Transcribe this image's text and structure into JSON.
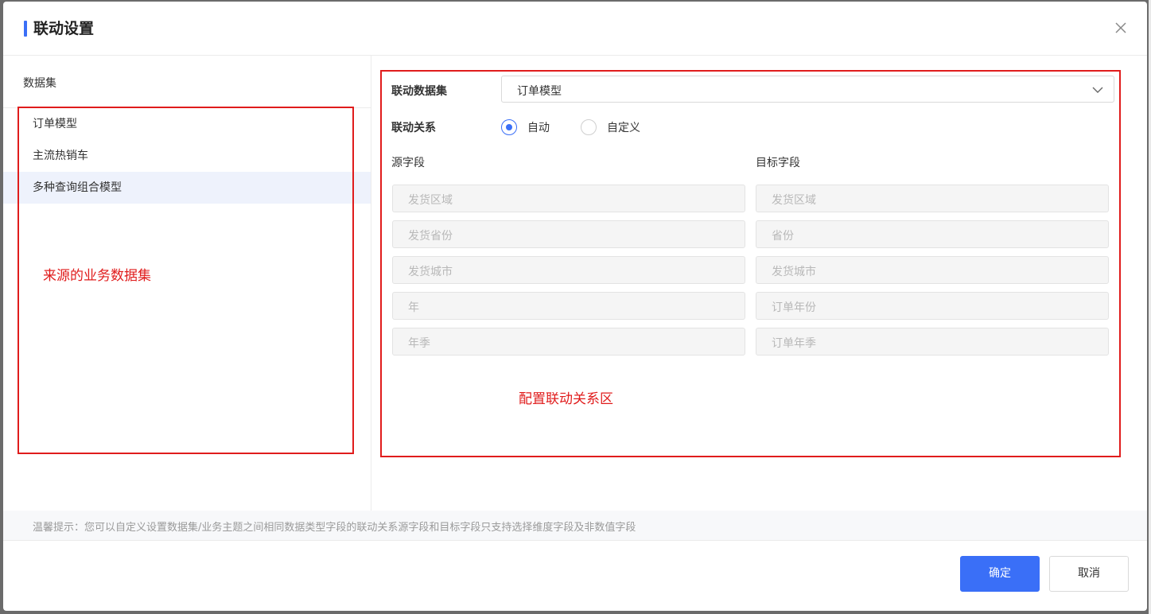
{
  "dialog": {
    "title": "联动设置",
    "accent_color": "#3a6ff7"
  },
  "left": {
    "header": "数据集",
    "items": [
      {
        "label": "订单模型",
        "active": false
      },
      {
        "label": "主流热销车",
        "active": false
      },
      {
        "label": "多种查询组合模型",
        "active": true
      }
    ]
  },
  "form": {
    "dataset_label": "联动数据集",
    "dataset_value": "订单模型",
    "relation_label": "联动关系",
    "relation_options": [
      "自动",
      "自定义"
    ],
    "relation_selected": "自动",
    "source_label": "源字段",
    "target_label": "目标字段",
    "source_fields": [
      "发货区域",
      "发货省份",
      "发货城市",
      "年",
      "年季"
    ],
    "target_fields": [
      "发货区域",
      "省份",
      "发货城市",
      "订单年份",
      "订单年季"
    ]
  },
  "annotations": {
    "left_note": "来源的业务数据集",
    "right_note": "配置联动关系区",
    "color": "#e01c1c"
  },
  "tip": "温馨提示：您可以自定义设置数据集/业务主题之间相同数据类型字段的联动关系源字段和目标字段只支持选择维度字段及非数值字段",
  "footer": {
    "confirm_label": "确定",
    "cancel_label": "取消"
  }
}
